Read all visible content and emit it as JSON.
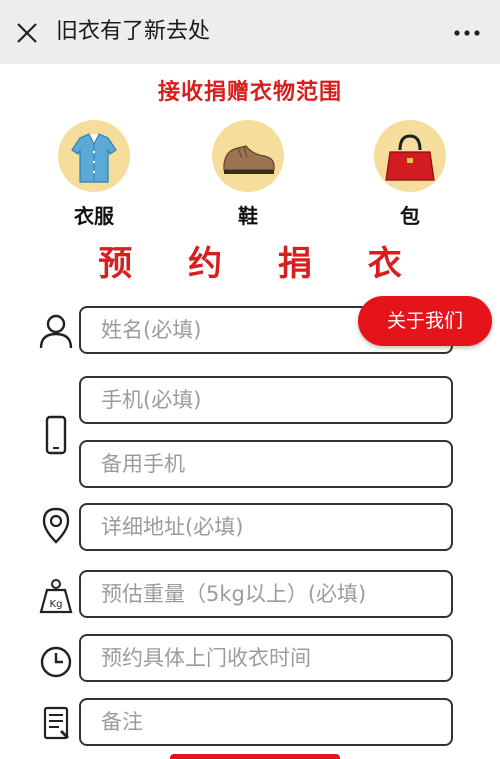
{
  "topbar": {
    "title": "旧衣有了新去处"
  },
  "section_heading": "接收捐赠衣物范围",
  "categories": [
    {
      "label": "衣服",
      "icon": "shirt-icon"
    },
    {
      "label": "鞋",
      "icon": "shoe-icon"
    },
    {
      "label": "包",
      "icon": "handbag-icon"
    }
  ],
  "form_title": "预 约 捐 衣",
  "about_button": "关于我们",
  "form": {
    "name_placeholder": "姓名(必填)",
    "phone_placeholder": "手机(必填)",
    "backup_phone_placeholder": "备用手机",
    "address_placeholder": "详细地址(必填)",
    "weight_placeholder": "预估重量（5kg以上）(必填)",
    "time_placeholder": "预约具体上门收衣时间",
    "notes_placeholder": "备注"
  },
  "weight_icon_text": "Kg",
  "colors": {
    "accent_red": "#d81e1e",
    "button_red": "#e5141b",
    "icon_circle": "#f5dd9c"
  }
}
